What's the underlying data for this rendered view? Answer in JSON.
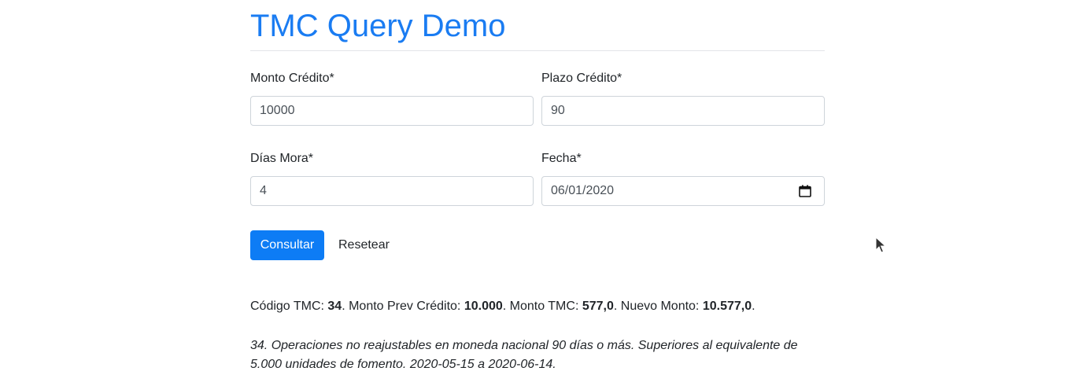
{
  "page": {
    "title": "TMC Query Demo"
  },
  "form": {
    "monto": {
      "label": "Monto Crédito*",
      "value": "10000"
    },
    "plazo": {
      "label": "Plazo Crédito*",
      "value": "90"
    },
    "dias_mora": {
      "label": "Días Mora*",
      "value": "4"
    },
    "fecha": {
      "label": "Fecha*",
      "value": "06/01/2020",
      "icon": "calendar-icon"
    }
  },
  "actions": {
    "consultar_label": "Consultar",
    "resetear_label": "Resetear"
  },
  "result": {
    "codigo_label": "Código TMC: ",
    "codigo_value": "34",
    "monto_prev_label": ". Monto Prev Crédito: ",
    "monto_prev_value": "10.000",
    "monto_tmc_label": ". Monto TMC: ",
    "monto_tmc_value": "577,0",
    "nuevo_monto_label": ". Nuevo Monto: ",
    "nuevo_monto_value": "10.577,0",
    "end": "."
  },
  "description": "34. Operaciones no reajustables en moneda nacional 90 días o más. Superiores al equivalente de 5.000 unidades de fomento. 2020-05-15 a 2020-06-14.",
  "colors": {
    "title": "#1a7cf2",
    "primary_button": "#0d7cf5"
  }
}
